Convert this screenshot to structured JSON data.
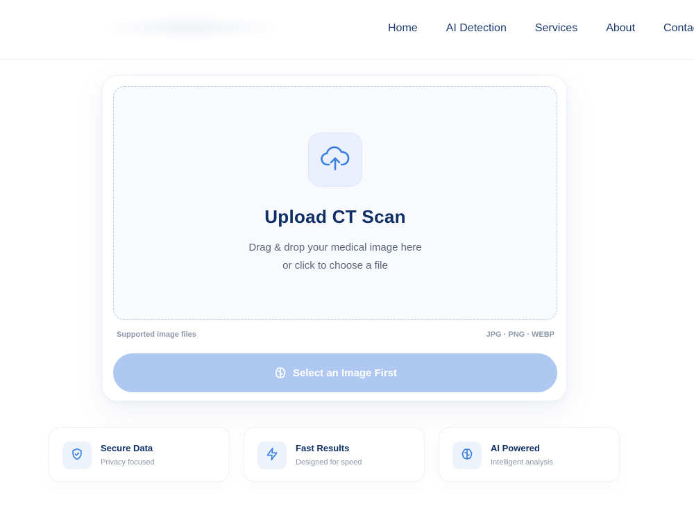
{
  "nav": {
    "items": [
      {
        "label": "Home"
      },
      {
        "label": "AI Detection"
      },
      {
        "label": "Services"
      },
      {
        "label": "About"
      },
      {
        "label": "Contact"
      }
    ]
  },
  "upload": {
    "icon": "cloud-upload-icon",
    "title": "Upload CT Scan",
    "subtitle_line1": "Drag & drop your medical image here",
    "subtitle_line2": "or click to choose a file",
    "supported_label": "Supported image files",
    "formats": "JPG · PNG · WEBP",
    "button_label": "Select an Image First",
    "button_icon": "brain-icon"
  },
  "features": [
    {
      "icon": "shield-check-icon",
      "title": "Secure Data",
      "subtitle": "Privacy focused"
    },
    {
      "icon": "lightning-icon",
      "title": "Fast Results",
      "subtitle": "Designed for speed"
    },
    {
      "icon": "brain-icon",
      "title": "AI Powered",
      "subtitle": "Intelligent analysis"
    }
  ],
  "colors": {
    "accent": "#3b82f6",
    "title": "#0f2f66",
    "button_disabled": "#afc8f1"
  }
}
